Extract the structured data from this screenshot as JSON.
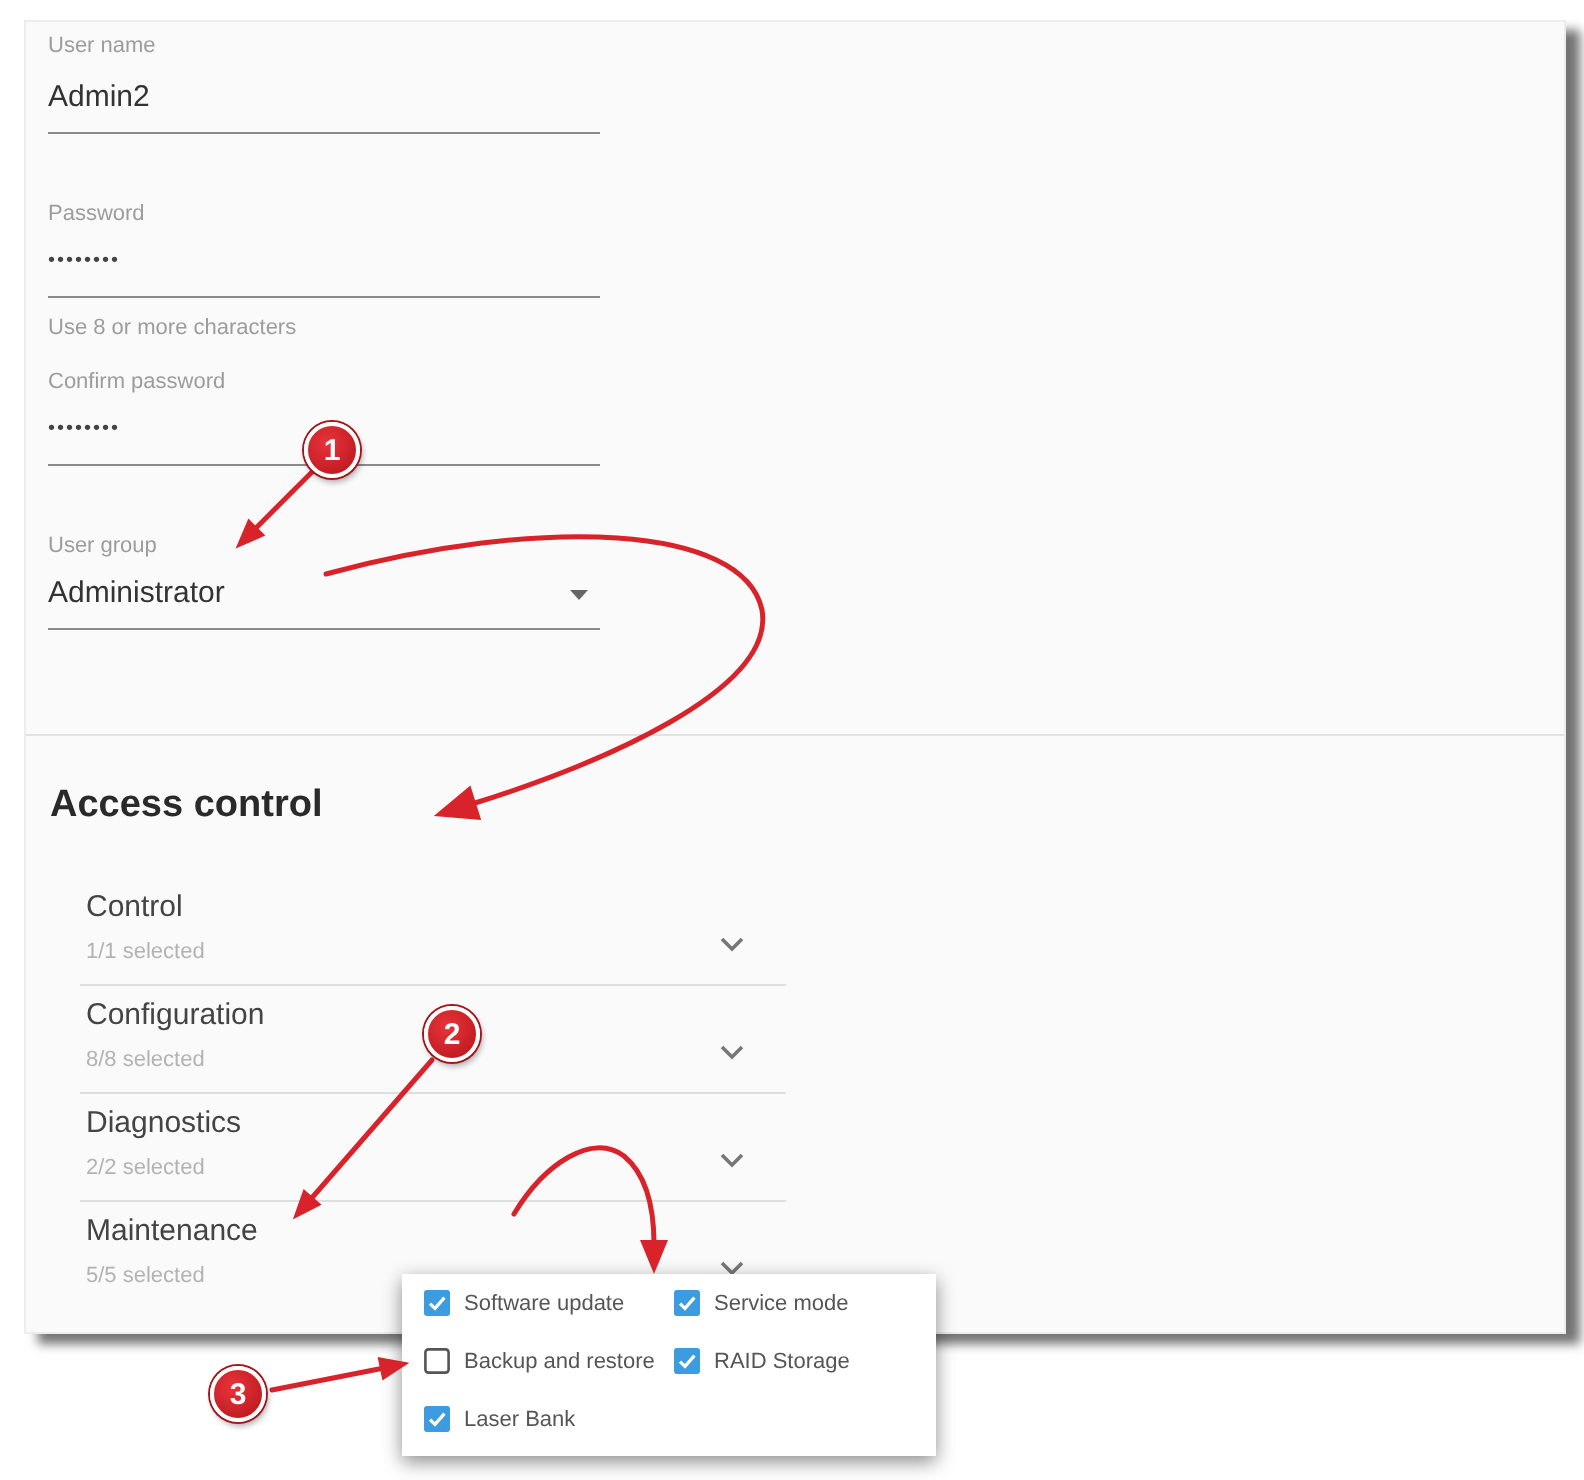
{
  "form": {
    "fields": [
      {
        "kind": "text",
        "label": "User name",
        "value": "Admin2"
      },
      {
        "kind": "password",
        "label": "Password",
        "value": "••••••••",
        "helper": "Use 8 or more characters"
      },
      {
        "kind": "password",
        "label": "Confirm password",
        "value": "••••••••"
      },
      {
        "kind": "dropdown",
        "label": "User group",
        "value": "Administrator"
      }
    ]
  },
  "access_control": {
    "title": "Access control",
    "groups": [
      {
        "title": "Control",
        "summary": "1/1 selected"
      },
      {
        "title": "Configuration",
        "summary": "8/8 selected"
      },
      {
        "title": "Diagnostics",
        "summary": "2/2 selected"
      },
      {
        "title": "Maintenance",
        "summary": "5/5 selected",
        "options": [
          {
            "label": "Software update",
            "checked": true
          },
          {
            "label": "Service mode",
            "checked": true
          },
          {
            "label": "Backup and restore",
            "checked": false
          },
          {
            "label": "RAID Storage",
            "checked": true
          },
          {
            "label": "Laser Bank",
            "checked": true
          }
        ]
      }
    ]
  },
  "callouts": [
    {
      "label": "1"
    },
    {
      "label": "2"
    },
    {
      "label": "3"
    }
  ]
}
